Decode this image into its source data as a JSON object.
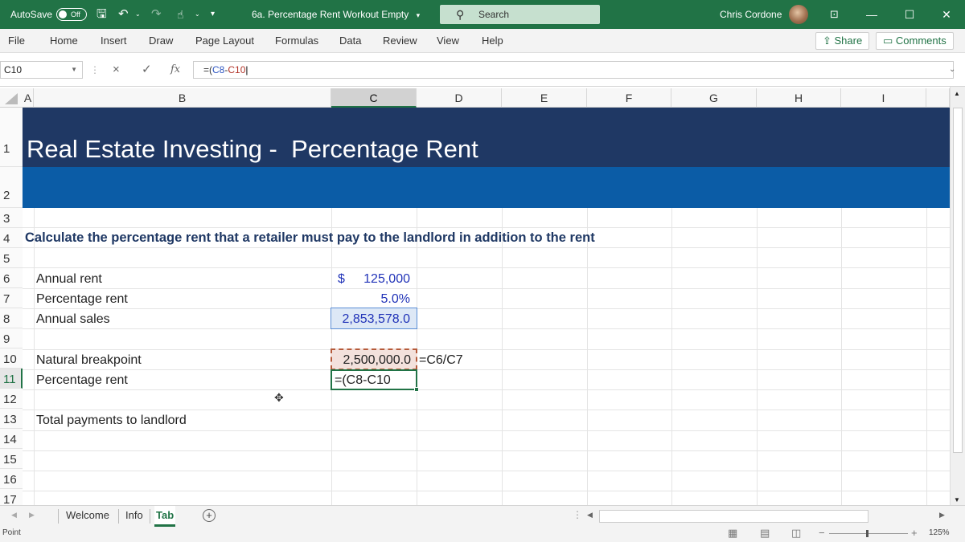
{
  "titlebar": {
    "autosave_label": "AutoSave",
    "autosave_state": "Off",
    "doc_title": "6a. Percentage Rent Workout Empty",
    "doc_title_arrow": "▾",
    "search_placeholder": "Search",
    "user_name": "Chris Cordone",
    "minimize": "—",
    "restore": "☐",
    "close": "✕"
  },
  "menu": {
    "items": [
      "File",
      "Home",
      "Insert",
      "Draw",
      "Page Layout",
      "Formulas",
      "Data",
      "Review",
      "View",
      "Help"
    ],
    "share": "Share",
    "comments": "Comments"
  },
  "formula_bar": {
    "name_box": "C10",
    "cancel": "×",
    "enter": "✓",
    "fx": "fx",
    "formula_prefix": "=(",
    "formula_ref1": "C8",
    "formula_op": "-",
    "formula_ref2": "C10"
  },
  "grid": {
    "columns": [
      "A",
      "B",
      "C",
      "D",
      "E",
      "F",
      "G",
      "H",
      "I"
    ],
    "selected_column": "C",
    "rows": [
      "1",
      "2",
      "3",
      "4",
      "5",
      "6",
      "7",
      "8",
      "9",
      "10",
      "11",
      "12",
      "13",
      "14",
      "15",
      "16",
      "17"
    ],
    "selected_row": "11"
  },
  "sheet": {
    "title": "Real Estate Investing -  Percentage Rent",
    "instruction": "Calculate the percentage rent that a retailer must pay to the landlord in addition to the rent",
    "labels": {
      "annual_rent": "Annual rent",
      "percentage_rent": "Percentage rent",
      "annual_sales": "Annual sales",
      "natural_breakpoint": "Natural breakpoint",
      "percentage_rent_2": "Percentage rent",
      "total_payments": "Total payments to landlord"
    },
    "values": {
      "annual_rent_currency": "$",
      "annual_rent": "125,000",
      "percentage_rent": "5.0%",
      "annual_sales": "2,853,578.0",
      "natural_breakpoint": "2,500,000.0",
      "natural_breakpoint_formula": "=C6/C7",
      "percentage_rent_editing": "=(C8-C10"
    }
  },
  "tabs": {
    "items": [
      "Welcome",
      "Info",
      "Tab"
    ],
    "active": "Tab",
    "add": "+"
  },
  "status": {
    "mode": "Point",
    "zoom": "125%"
  },
  "colors": {
    "excel_green": "#217346",
    "banner_dark": "#1f3864",
    "banner_blue": "#0b5ca6",
    "input_blue": "#2133b8"
  }
}
